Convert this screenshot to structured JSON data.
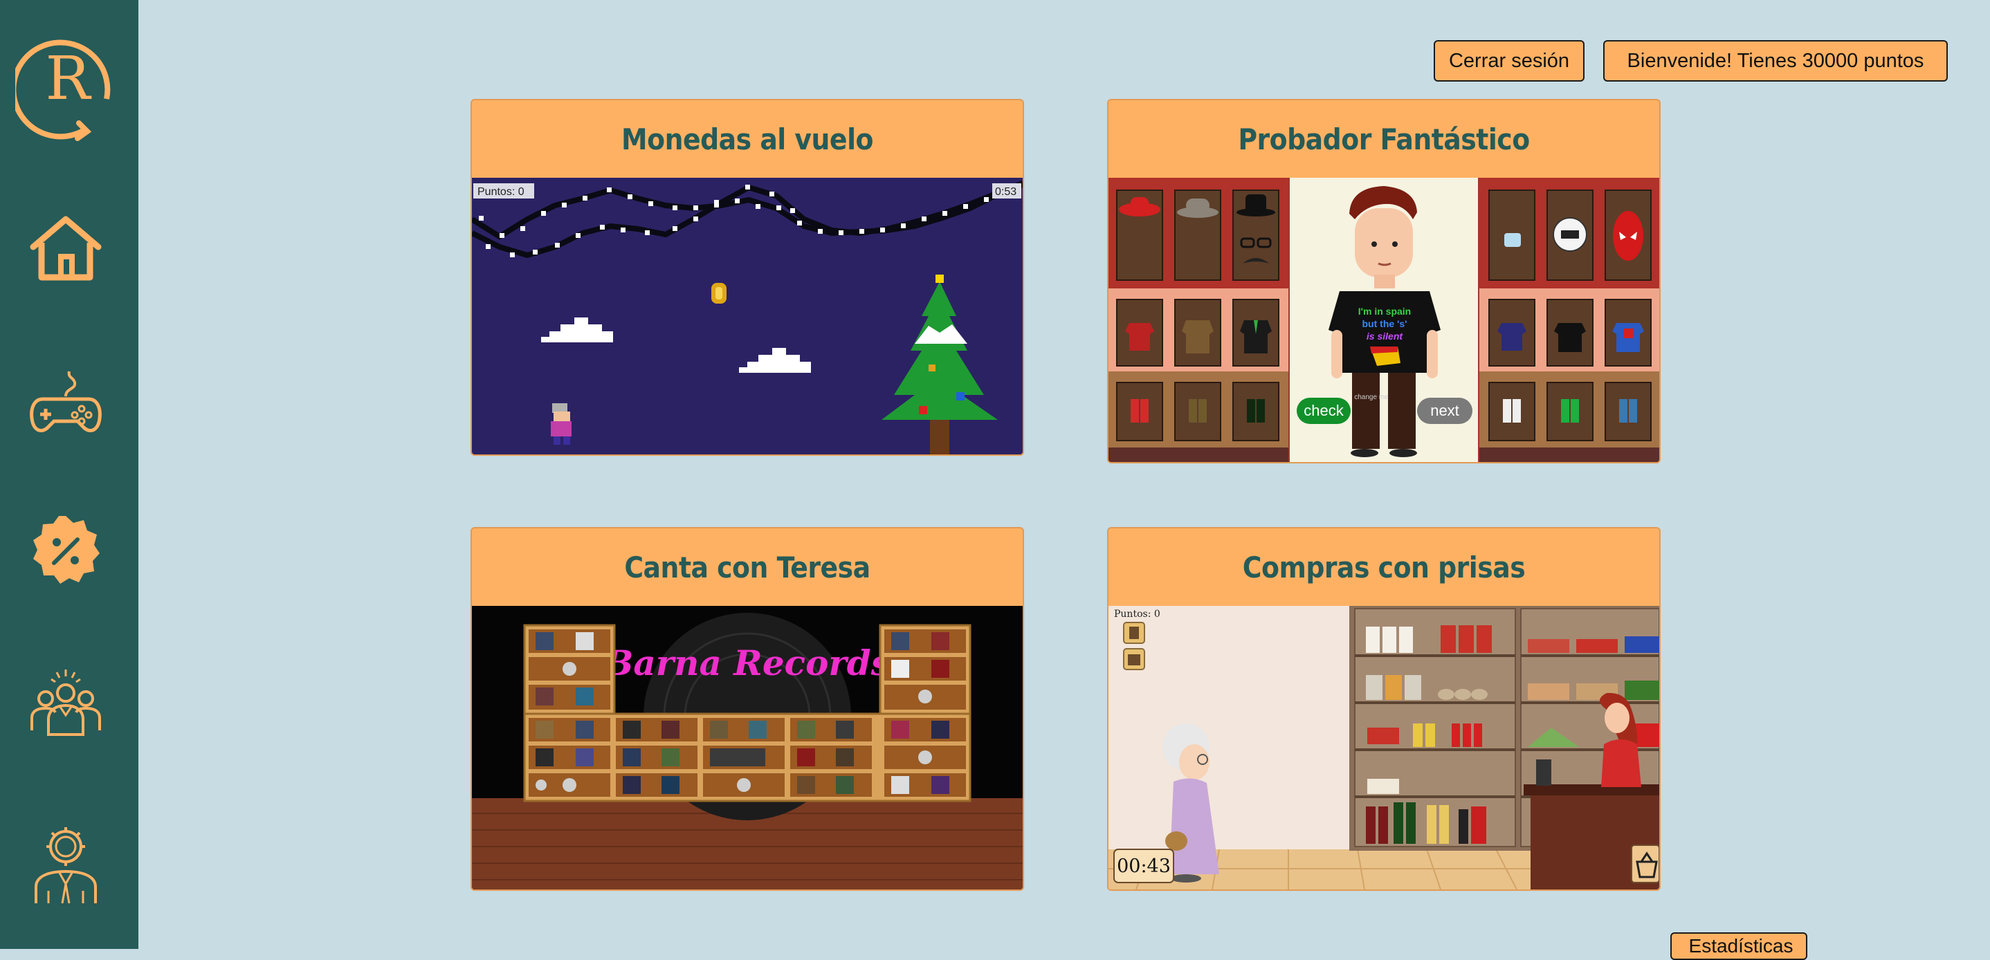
{
  "header": {
    "logout_label": "Cerrar sesión",
    "welcome_label": "Bienvenide! Tienes 30000 puntos"
  },
  "sidebar": {
    "logo_letter": "R",
    "items": [
      {
        "icon": "home-icon"
      },
      {
        "icon": "gamepad-icon"
      },
      {
        "icon": "discount-badge-icon"
      },
      {
        "icon": "community-icon"
      },
      {
        "icon": "profile-icon"
      }
    ]
  },
  "games": [
    {
      "title": "Monedas al vuelo",
      "hud_score": "Puntos: 0",
      "hud_time": "0:53"
    },
    {
      "title": "Probador Fantástico",
      "shirt_line1": "I'm in spain",
      "shirt_line2": "but the 's'",
      "shirt_line3": "is silent",
      "check_label": "check",
      "next_label": "next",
      "change_label": "change me"
    },
    {
      "title": "Canta con Teresa",
      "sign_text": "Barna Records"
    },
    {
      "title": "Compras con prisas",
      "hud_score": "Puntos: 0",
      "timer": "00:43"
    }
  ],
  "footer": {
    "stats_label": "Estadísticas"
  },
  "colors": {
    "sidebar": "#265b58",
    "accent": "#ffb163",
    "background": "#c8dce3",
    "title_text": "#265b58"
  }
}
